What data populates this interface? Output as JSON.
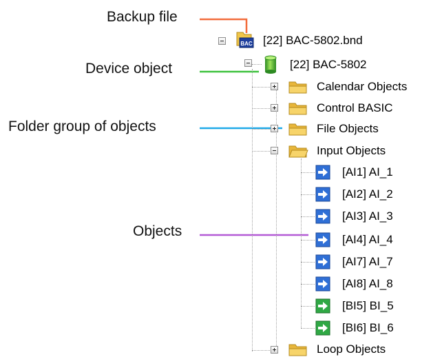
{
  "callouts": {
    "backup_file": "Backup file",
    "device_object": "Device object",
    "folder_group": "Folder group of objects",
    "objects": "Objects"
  },
  "tree": {
    "backup_file": {
      "label": "[22] BAC-5802.bnd",
      "icon": "bac-file-icon",
      "expanded": true
    },
    "device": {
      "label": "[22] BAC-5802",
      "icon": "device-cylinder-icon",
      "expanded": true
    },
    "folders": [
      {
        "label": "Calendar Objects",
        "icon": "folder-icon",
        "expanded": false
      },
      {
        "label": "Control BASIC",
        "icon": "folder-icon",
        "expanded": false
      },
      {
        "label": "File Objects",
        "icon": "folder-icon",
        "expanded": false
      },
      {
        "label": "Input Objects",
        "icon": "folder-open-icon",
        "expanded": true
      },
      {
        "label": "Loop Objects",
        "icon": "folder-icon",
        "expanded": false
      }
    ],
    "input_objects": [
      {
        "label": "[AI1] AI_1",
        "icon": "analog-input-icon"
      },
      {
        "label": "[AI2] AI_2",
        "icon": "analog-input-icon"
      },
      {
        "label": "[AI3] AI_3",
        "icon": "analog-input-icon"
      },
      {
        "label": "[AI4] AI_4",
        "icon": "analog-input-icon"
      },
      {
        "label": "[AI7] AI_7",
        "icon": "analog-input-icon"
      },
      {
        "label": "[AI8] AI_8",
        "icon": "analog-input-icon"
      },
      {
        "label": "[BI5] BI_5",
        "icon": "binary-input-icon"
      },
      {
        "label": "[BI6] BI_6",
        "icon": "binary-input-icon"
      }
    ]
  },
  "colors": {
    "backup_leader": "#f26b3a",
    "device_leader": "#3cc23c",
    "folder_leader": "#1fa9e8",
    "objects_leader": "#b45ad6",
    "analog_icon": "#2f6fd6",
    "binary_icon": "#2fa844",
    "folder": "#f0c64a"
  }
}
